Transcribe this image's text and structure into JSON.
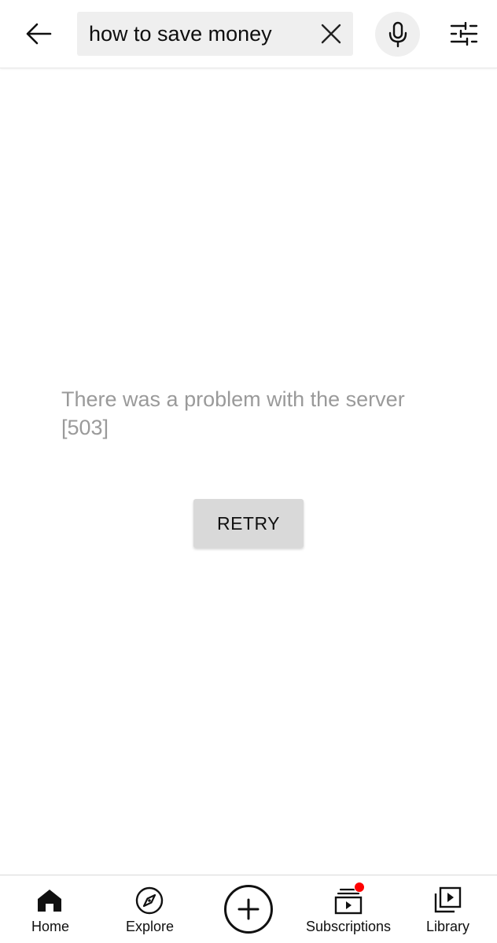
{
  "search": {
    "query": "how to save money"
  },
  "error": {
    "message": "There was a problem with the server [503]",
    "retry_label": "RETRY"
  },
  "nav": {
    "home": "Home",
    "explore": "Explore",
    "subscriptions": "Subscriptions",
    "library": "Library"
  },
  "colors": {
    "badge": "#ff0000",
    "error_text": "#9a9a9a",
    "retry_bg": "#d9d9d9"
  }
}
